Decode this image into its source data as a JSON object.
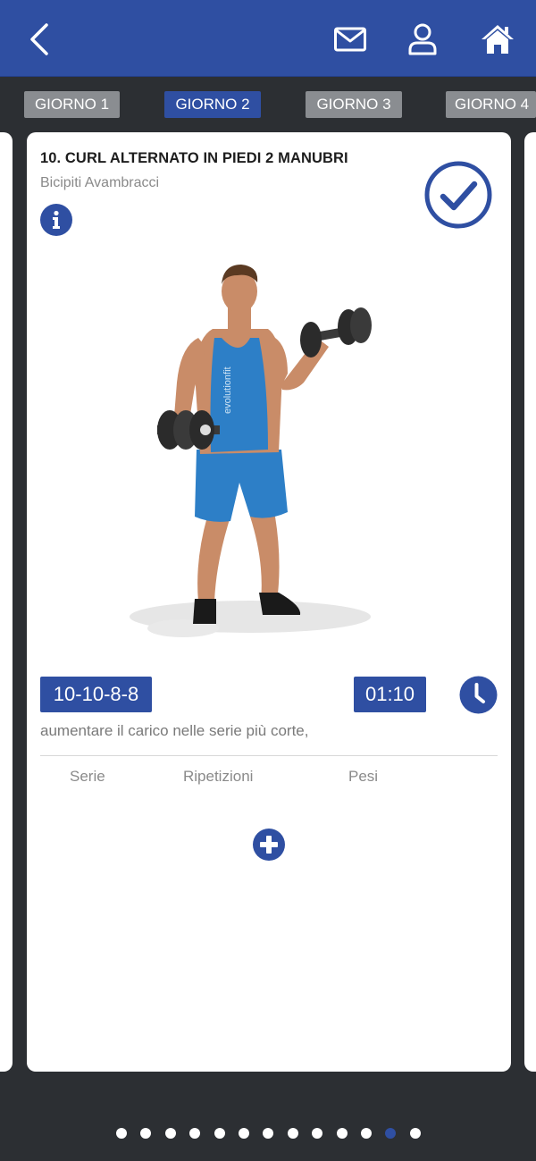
{
  "header": {
    "back_icon": "chevron-left-icon",
    "mail_icon": "mail-icon",
    "user_icon": "user-icon",
    "home_icon": "home-icon"
  },
  "tabs": [
    {
      "label": "GIORNO 1",
      "active": false
    },
    {
      "label": "GIORNO 2",
      "active": true
    },
    {
      "label": "GIORNO 3",
      "active": false
    },
    {
      "label": "GIORNO 4",
      "active": false
    }
  ],
  "exercise": {
    "title": "10. CURL ALTERNATO IN PIEDI 2 MANUBRI",
    "muscles": "Bicipiti Avambracci",
    "info_icon": "info-icon",
    "check_icon": "check-circle-icon",
    "shirt_text": "evolutionfit",
    "reps": "10-10-8-8",
    "rest": "01:10",
    "clock_icon": "clock-icon",
    "note": "aumentare il carico nelle serie più corte,"
  },
  "table": {
    "columns": [
      "Serie",
      "Ripetizioni",
      "Pesi"
    ],
    "add_icon": "plus-circle-icon"
  },
  "pager": {
    "total": 13,
    "active_index": 11
  },
  "colors": {
    "primary": "#2f4fa2",
    "background": "#2c2f33",
    "tab_inactive": "#8a8d91"
  }
}
